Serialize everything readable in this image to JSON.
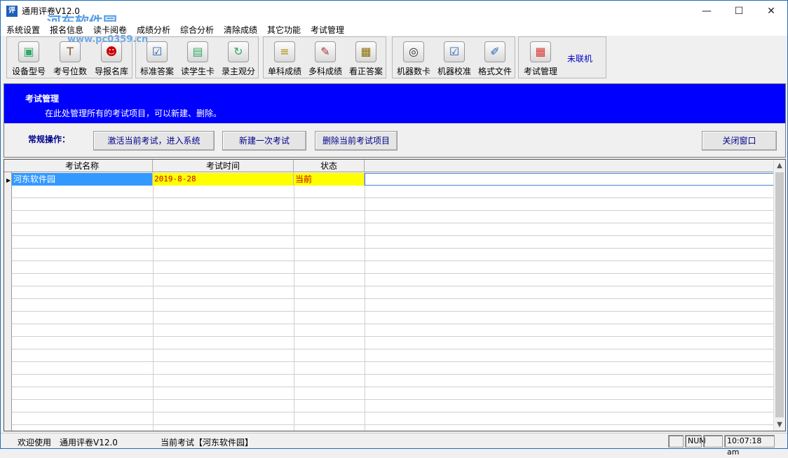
{
  "window": {
    "title": "通用评卷V12.0",
    "app_icon_glyph": "评",
    "watermark": "河东软件园",
    "watermark_url": "www.pc0359.cn",
    "controls": {
      "minimize": "—",
      "maximize": "☐",
      "close": "✕"
    }
  },
  "menu": [
    "系统设置",
    "报名信息",
    "读卡阅卷",
    "成绩分析",
    "综合分析",
    "清除成绩",
    "其它功能",
    "考试管理"
  ],
  "toolbar": {
    "groups": [
      [
        {
          "label": "设备型号",
          "icon": "device-icon"
        },
        {
          "label": "考号位数",
          "icon": "hammer-icon"
        },
        {
          "label": "导报名库",
          "icon": "person-icon"
        }
      ],
      [
        {
          "label": "标准答案",
          "icon": "checkbox-icon"
        },
        {
          "label": "读学生卡",
          "icon": "card-reader-icon"
        },
        {
          "label": "录主观分",
          "icon": "refresh-icon"
        }
      ],
      [
        {
          "label": "单科成绩",
          "icon": "document-icon"
        },
        {
          "label": "多科成绩",
          "icon": "pen-paper-icon"
        },
        {
          "label": "看正答案",
          "icon": "pages-icon"
        }
      ],
      [
        {
          "label": "机器数卡",
          "icon": "film-reel-icon"
        },
        {
          "label": "机器校准",
          "icon": "checklist-icon"
        },
        {
          "label": "格式文件",
          "icon": "edit-icon"
        }
      ],
      [
        {
          "label": "考试管理",
          "icon": "grid-icon"
        }
      ]
    ],
    "status": "未联机"
  },
  "banner": {
    "title": "考试管理",
    "description": "在此处管理所有的考试项目，可以新建、删除。"
  },
  "operations": {
    "label": "常规操作：",
    "activate": "激活当前考试，进入系统",
    "new_exam": "新建一次考试",
    "delete_exam": "删除当前考试项目",
    "close": "关闭窗口"
  },
  "grid": {
    "columns": [
      "考试名称",
      "考试时间",
      "状态"
    ],
    "rows": [
      {
        "name": "河东软件园",
        "date": "2019-8-28",
        "status": "当前"
      }
    ]
  },
  "statusbar": {
    "welcome": "欢迎使用",
    "version": "通用评卷V12.0",
    "current_exam": "当前考试【河东软件园】",
    "num": "NUM",
    "time": "10:07:18 am"
  }
}
